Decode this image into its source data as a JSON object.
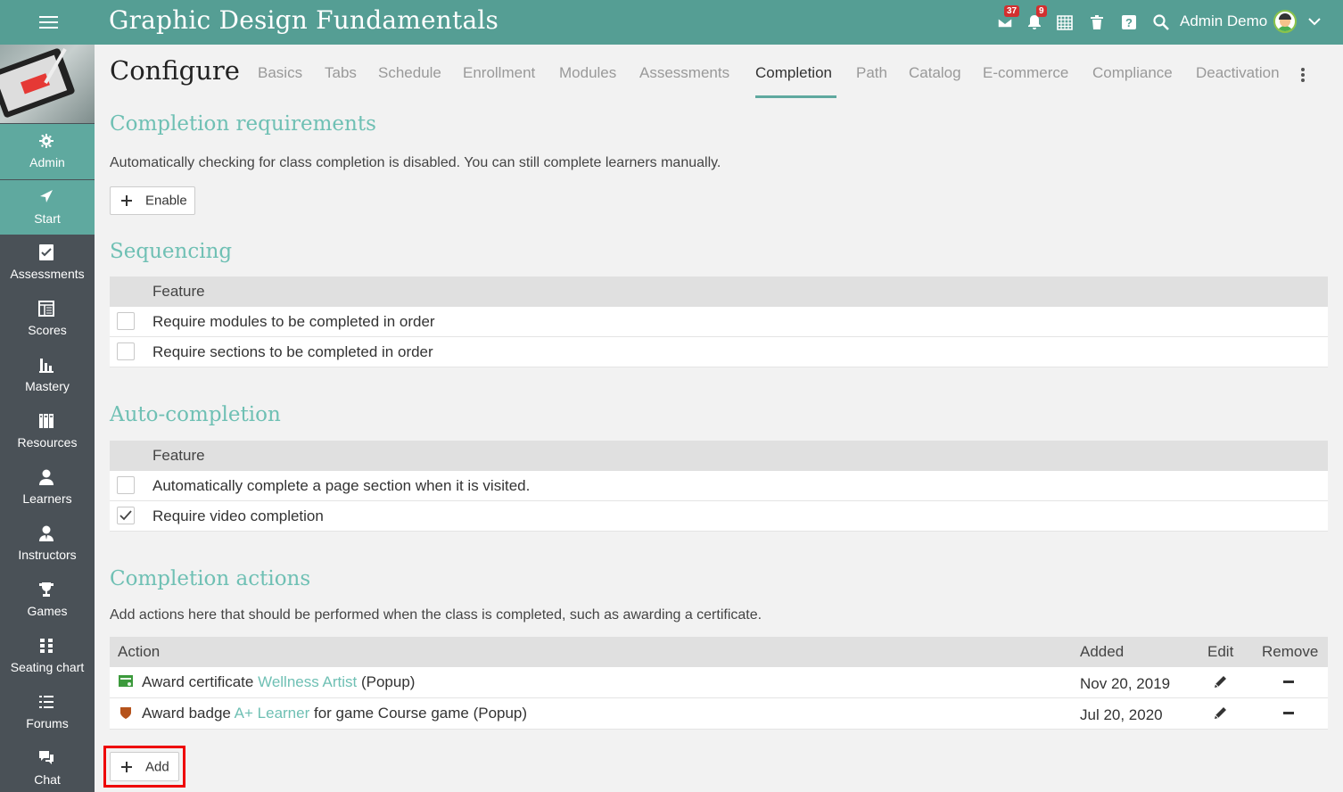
{
  "topbar": {
    "title": "Graphic Design Fundamentals",
    "mail_badge": "37",
    "notif_badge": "9",
    "user_name": "Admin Demo",
    "icons": [
      "menu-icon",
      "mail-icon",
      "bell-icon",
      "calendar-icon",
      "trash-icon",
      "help-icon",
      "search-icon",
      "chevron-down-icon"
    ]
  },
  "sidebar": {
    "items": [
      {
        "label": "Admin",
        "icon": "gear-icon"
      },
      {
        "label": "Start",
        "icon": "navigation-arrow-icon"
      },
      {
        "label": "Assessments",
        "icon": "checkbox-icon"
      },
      {
        "label": "Scores",
        "icon": "gradebook-icon"
      },
      {
        "label": "Mastery",
        "icon": "bar-chart-icon"
      },
      {
        "label": "Resources",
        "icon": "books-icon"
      },
      {
        "label": "Learners",
        "icon": "person-icon"
      },
      {
        "label": "Instructors",
        "icon": "instructor-icon"
      },
      {
        "label": "Games",
        "icon": "trophy-icon"
      },
      {
        "label": "Seating chart",
        "icon": "seating-grid-icon"
      },
      {
        "label": "Forums",
        "icon": "list-icon"
      },
      {
        "label": "Chat",
        "icon": "chat-bubbles-icon"
      }
    ]
  },
  "page": {
    "title": "Configure",
    "tabs": [
      "Basics",
      "Tabs",
      "Schedule",
      "Enrollment",
      "Modules",
      "Assessments",
      "Completion",
      "Path",
      "Catalog",
      "E-commerce",
      "Compliance",
      "Deactivation"
    ],
    "active_tab": "Completion"
  },
  "completion_requirements": {
    "title": "Completion requirements",
    "text": "Automatically checking for class completion is disabled. You can still complete learners manually.",
    "enable_label": "Enable"
  },
  "sequencing": {
    "title": "Sequencing",
    "header": "Feature",
    "rows": [
      {
        "label": "Require modules to be completed in order",
        "checked": false
      },
      {
        "label": "Require sections to be completed in order",
        "checked": false
      }
    ]
  },
  "auto_completion": {
    "title": "Auto-completion",
    "header": "Feature",
    "rows": [
      {
        "label": "Automatically complete a page section when it is visited.",
        "checked": false
      },
      {
        "label": "Require video completion",
        "checked": true
      }
    ]
  },
  "completion_actions": {
    "title": "Completion actions",
    "text": "Add actions here that should be performed when the class is completed, such as awarding a certificate.",
    "headers": {
      "action": "Action",
      "added": "Added",
      "edit": "Edit",
      "remove": "Remove"
    },
    "rows": [
      {
        "prefix": "Award certificate ",
        "link": "Wellness Artist",
        "suffix": " (Popup)",
        "added": "Nov 20, 2019",
        "icon": "certificate-icon"
      },
      {
        "prefix": "Award badge ",
        "link": "A+ Learner",
        "suffix": " for game Course game (Popup)",
        "added": "Jul 20, 2020",
        "icon": "badge-shield-icon"
      }
    ],
    "add_label": "Add"
  }
}
